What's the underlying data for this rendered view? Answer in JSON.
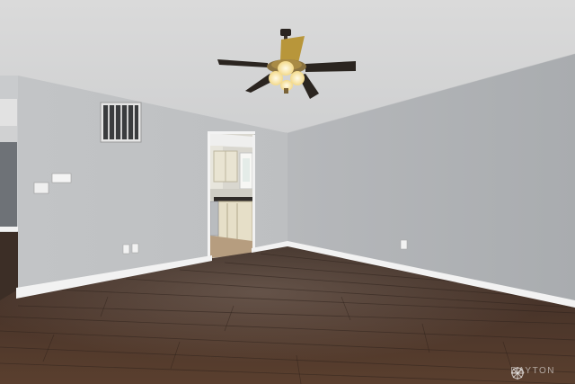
{
  "photo": {
    "subject": "empty-room-interior",
    "colors": {
      "ceiling": "#d9d9d9",
      "wall_left": "#c4c6c8",
      "wall_right": "#b3b6b9",
      "floor": "#4a352a",
      "baseboard": "#f2f2f2"
    }
  },
  "watermark": {
    "text": "DAYTON"
  }
}
